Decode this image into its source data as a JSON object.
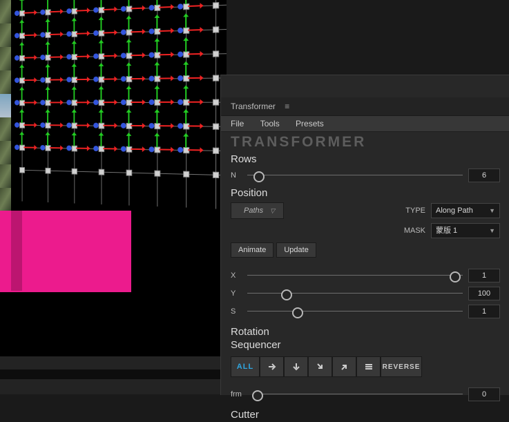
{
  "panel_title": "Transformer",
  "menu": {
    "file": "File",
    "tools": "Tools",
    "presets": "Presets"
  },
  "brand": "TRANSFORMER",
  "sections": {
    "rows": "Rows",
    "position": "Position",
    "rotation": "Rotation",
    "sequencer": "Sequencer",
    "cutter": "Cutter"
  },
  "controls": {
    "n": "N",
    "x": "X",
    "y": "Y",
    "s": "S",
    "frm": "frm"
  },
  "values": {
    "rows": "6",
    "x": "1",
    "y": "100",
    "s": "1",
    "frm": "0"
  },
  "labels": {
    "type": "TYPE",
    "mask": "MASK"
  },
  "buttons": {
    "paths": "Paths",
    "animate": "Animate",
    "update": "Update",
    "all": "ALL",
    "reverse": "REVERSE"
  },
  "dropdowns": {
    "type_value": "Along Path",
    "mask_value": "蒙版 1"
  }
}
